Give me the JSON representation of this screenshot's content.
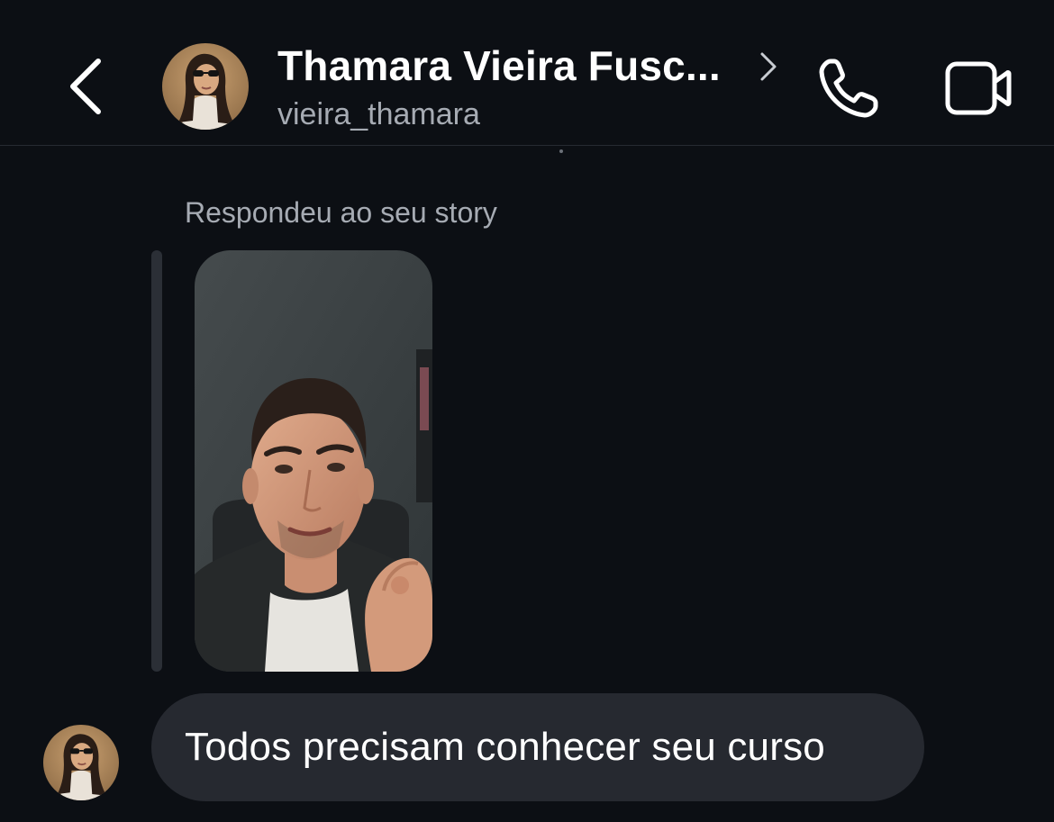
{
  "header": {
    "back_icon": "chevron-left-icon",
    "contact_name": "Thamara Vieira Fusc...",
    "username": "vieira_thamara",
    "profile_chevron_icon": "chevron-right-icon",
    "call_icon": "phone-icon",
    "video_icon": "video-camera-icon"
  },
  "conversation": {
    "story_reply_label": "Respondeu ao seu story",
    "messages": [
      {
        "text": "Todos precisam conhecer seu curso"
      }
    ]
  },
  "colors": {
    "background": "#0c0f14",
    "bubble": "#262930",
    "secondary_text": "#a6abb3",
    "reply_bar": "#2b2f36"
  }
}
